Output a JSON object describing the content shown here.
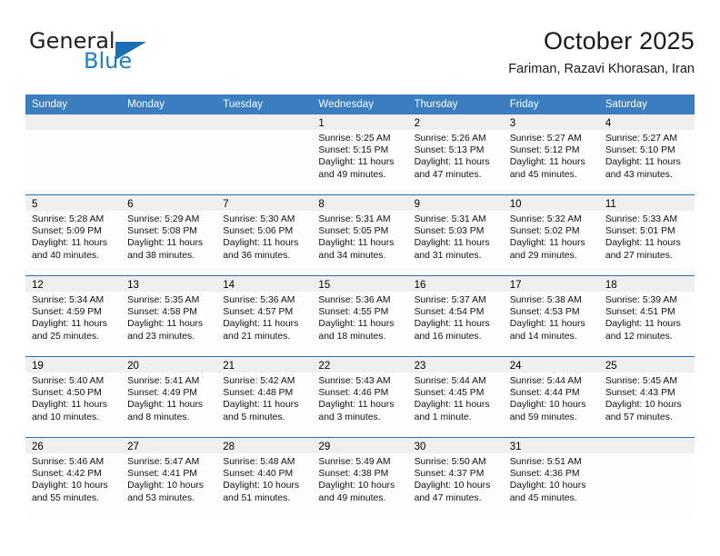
{
  "brand": {
    "name_part1": "General",
    "name_part2": "Blue",
    "logo_icon": "triangle-logo-icon"
  },
  "header": {
    "title": "October 2025",
    "subtitle": "Fariman, Razavi Khorasan, Iran"
  },
  "colors": {
    "header_bar": "#3a7ebf",
    "row_divider": "#2d6fae",
    "day_band": "#efefef",
    "brand_blue": "#1f7fc6"
  },
  "weekdays": [
    "Sunday",
    "Monday",
    "Tuesday",
    "Wednesday",
    "Thursday",
    "Friday",
    "Saturday"
  ],
  "weeks": [
    [
      {
        "day": "",
        "sunrise": "",
        "sunset": "",
        "daylight": "",
        "daylight2": ""
      },
      {
        "day": "",
        "sunrise": "",
        "sunset": "",
        "daylight": "",
        "daylight2": ""
      },
      {
        "day": "",
        "sunrise": "",
        "sunset": "",
        "daylight": "",
        "daylight2": ""
      },
      {
        "day": "1",
        "sunrise": "Sunrise: 5:25 AM",
        "sunset": "Sunset: 5:15 PM",
        "daylight": "Daylight: 11 hours",
        "daylight2": "and 49 minutes."
      },
      {
        "day": "2",
        "sunrise": "Sunrise: 5:26 AM",
        "sunset": "Sunset: 5:13 PM",
        "daylight": "Daylight: 11 hours",
        "daylight2": "and 47 minutes."
      },
      {
        "day": "3",
        "sunrise": "Sunrise: 5:27 AM",
        "sunset": "Sunset: 5:12 PM",
        "daylight": "Daylight: 11 hours",
        "daylight2": "and 45 minutes."
      },
      {
        "day": "4",
        "sunrise": "Sunrise: 5:27 AM",
        "sunset": "Sunset: 5:10 PM",
        "daylight": "Daylight: 11 hours",
        "daylight2": "and 43 minutes."
      }
    ],
    [
      {
        "day": "5",
        "sunrise": "Sunrise: 5:28 AM",
        "sunset": "Sunset: 5:09 PM",
        "daylight": "Daylight: 11 hours",
        "daylight2": "and 40 minutes."
      },
      {
        "day": "6",
        "sunrise": "Sunrise: 5:29 AM",
        "sunset": "Sunset: 5:08 PM",
        "daylight": "Daylight: 11 hours",
        "daylight2": "and 38 minutes."
      },
      {
        "day": "7",
        "sunrise": "Sunrise: 5:30 AM",
        "sunset": "Sunset: 5:06 PM",
        "daylight": "Daylight: 11 hours",
        "daylight2": "and 36 minutes."
      },
      {
        "day": "8",
        "sunrise": "Sunrise: 5:31 AM",
        "sunset": "Sunset: 5:05 PM",
        "daylight": "Daylight: 11 hours",
        "daylight2": "and 34 minutes."
      },
      {
        "day": "9",
        "sunrise": "Sunrise: 5:31 AM",
        "sunset": "Sunset: 5:03 PM",
        "daylight": "Daylight: 11 hours",
        "daylight2": "and 31 minutes."
      },
      {
        "day": "10",
        "sunrise": "Sunrise: 5:32 AM",
        "sunset": "Sunset: 5:02 PM",
        "daylight": "Daylight: 11 hours",
        "daylight2": "and 29 minutes."
      },
      {
        "day": "11",
        "sunrise": "Sunrise: 5:33 AM",
        "sunset": "Sunset: 5:01 PM",
        "daylight": "Daylight: 11 hours",
        "daylight2": "and 27 minutes."
      }
    ],
    [
      {
        "day": "12",
        "sunrise": "Sunrise: 5:34 AM",
        "sunset": "Sunset: 4:59 PM",
        "daylight": "Daylight: 11 hours",
        "daylight2": "and 25 minutes."
      },
      {
        "day": "13",
        "sunrise": "Sunrise: 5:35 AM",
        "sunset": "Sunset: 4:58 PM",
        "daylight": "Daylight: 11 hours",
        "daylight2": "and 23 minutes."
      },
      {
        "day": "14",
        "sunrise": "Sunrise: 5:36 AM",
        "sunset": "Sunset: 4:57 PM",
        "daylight": "Daylight: 11 hours",
        "daylight2": "and 21 minutes."
      },
      {
        "day": "15",
        "sunrise": "Sunrise: 5:36 AM",
        "sunset": "Sunset: 4:55 PM",
        "daylight": "Daylight: 11 hours",
        "daylight2": "and 18 minutes."
      },
      {
        "day": "16",
        "sunrise": "Sunrise: 5:37 AM",
        "sunset": "Sunset: 4:54 PM",
        "daylight": "Daylight: 11 hours",
        "daylight2": "and 16 minutes."
      },
      {
        "day": "17",
        "sunrise": "Sunrise: 5:38 AM",
        "sunset": "Sunset: 4:53 PM",
        "daylight": "Daylight: 11 hours",
        "daylight2": "and 14 minutes."
      },
      {
        "day": "18",
        "sunrise": "Sunrise: 5:39 AM",
        "sunset": "Sunset: 4:51 PM",
        "daylight": "Daylight: 11 hours",
        "daylight2": "and 12 minutes."
      }
    ],
    [
      {
        "day": "19",
        "sunrise": "Sunrise: 5:40 AM",
        "sunset": "Sunset: 4:50 PM",
        "daylight": "Daylight: 11 hours",
        "daylight2": "and 10 minutes."
      },
      {
        "day": "20",
        "sunrise": "Sunrise: 5:41 AM",
        "sunset": "Sunset: 4:49 PM",
        "daylight": "Daylight: 11 hours",
        "daylight2": "and 8 minutes."
      },
      {
        "day": "21",
        "sunrise": "Sunrise: 5:42 AM",
        "sunset": "Sunset: 4:48 PM",
        "daylight": "Daylight: 11 hours",
        "daylight2": "and 5 minutes."
      },
      {
        "day": "22",
        "sunrise": "Sunrise: 5:43 AM",
        "sunset": "Sunset: 4:46 PM",
        "daylight": "Daylight: 11 hours",
        "daylight2": "and 3 minutes."
      },
      {
        "day": "23",
        "sunrise": "Sunrise: 5:44 AM",
        "sunset": "Sunset: 4:45 PM",
        "daylight": "Daylight: 11 hours",
        "daylight2": "and 1 minute."
      },
      {
        "day": "24",
        "sunrise": "Sunrise: 5:44 AM",
        "sunset": "Sunset: 4:44 PM",
        "daylight": "Daylight: 10 hours",
        "daylight2": "and 59 minutes."
      },
      {
        "day": "25",
        "sunrise": "Sunrise: 5:45 AM",
        "sunset": "Sunset: 4:43 PM",
        "daylight": "Daylight: 10 hours",
        "daylight2": "and 57 minutes."
      }
    ],
    [
      {
        "day": "26",
        "sunrise": "Sunrise: 5:46 AM",
        "sunset": "Sunset: 4:42 PM",
        "daylight": "Daylight: 10 hours",
        "daylight2": "and 55 minutes."
      },
      {
        "day": "27",
        "sunrise": "Sunrise: 5:47 AM",
        "sunset": "Sunset: 4:41 PM",
        "daylight": "Daylight: 10 hours",
        "daylight2": "and 53 minutes."
      },
      {
        "day": "28",
        "sunrise": "Sunrise: 5:48 AM",
        "sunset": "Sunset: 4:40 PM",
        "daylight": "Daylight: 10 hours",
        "daylight2": "and 51 minutes."
      },
      {
        "day": "29",
        "sunrise": "Sunrise: 5:49 AM",
        "sunset": "Sunset: 4:38 PM",
        "daylight": "Daylight: 10 hours",
        "daylight2": "and 49 minutes."
      },
      {
        "day": "30",
        "sunrise": "Sunrise: 5:50 AM",
        "sunset": "Sunset: 4:37 PM",
        "daylight": "Daylight: 10 hours",
        "daylight2": "and 47 minutes."
      },
      {
        "day": "31",
        "sunrise": "Sunrise: 5:51 AM",
        "sunset": "Sunset: 4:36 PM",
        "daylight": "Daylight: 10 hours",
        "daylight2": "and 45 minutes."
      },
      {
        "day": "",
        "sunrise": "",
        "sunset": "",
        "daylight": "",
        "daylight2": ""
      }
    ]
  ]
}
